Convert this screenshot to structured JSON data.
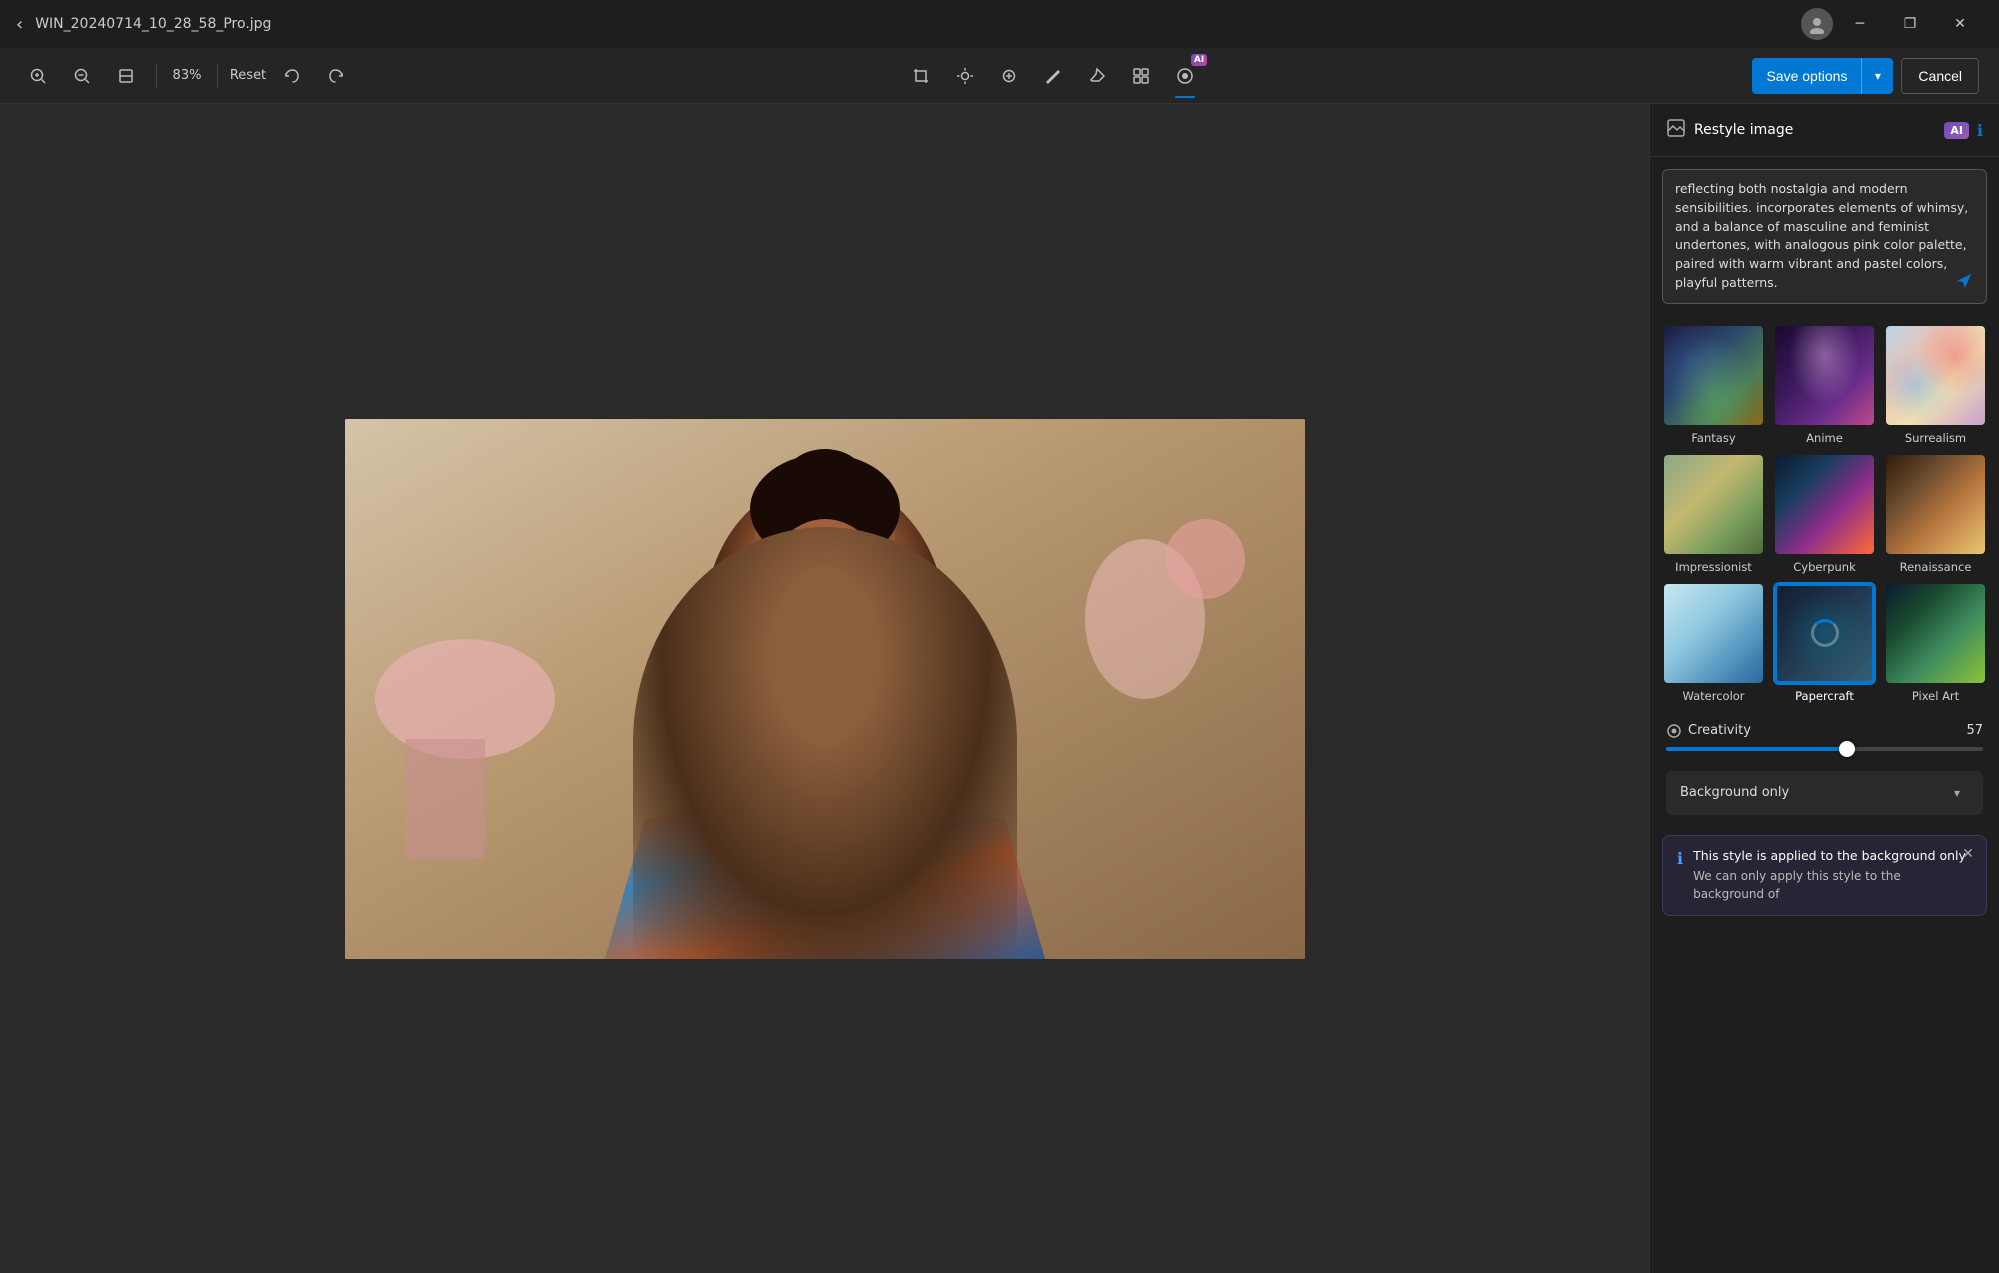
{
  "titlebar": {
    "back_icon": "‹",
    "title": "WIN_20240714_10_28_58_Pro.jpg",
    "avatar_icon": "👤",
    "minimize_icon": "─",
    "restore_icon": "❐",
    "close_icon": "✕"
  },
  "toolbar": {
    "zoom_in_icon": "🔍+",
    "zoom_out_icon": "🔍-",
    "fit_icon": "⊡",
    "zoom_value": "83%",
    "reset_label": "Reset",
    "undo_icon": "↩",
    "redo_icon": "↪",
    "crop_icon": "⤢",
    "brightness_icon": "☀",
    "spot_fix_icon": "⊕",
    "draw_icon": "✏",
    "erase_icon": "◈",
    "filter_icon": "⊞",
    "ai_icon": "AI",
    "save_options_label": "Save options",
    "save_options_arrow": "▾",
    "cancel_label": "Cancel"
  },
  "panel": {
    "header": {
      "icon": "🖼",
      "title": "Restyle image",
      "ai_badge": "AI",
      "info_icon": "ℹ"
    },
    "prompt_text": "reflecting both nostalgia and modern sensibilities. incorporates elements of whimsy, and a balance of masculine and feminist undertones, with analogous pink color palette, paired with warm vibrant and pastel colors, playful patterns.",
    "send_icon": "➤",
    "styles": [
      {
        "id": "fantasy",
        "label": "Fantasy",
        "thumb_class": "thumb-fantasy",
        "selected": false
      },
      {
        "id": "anime",
        "label": "Anime",
        "thumb_class": "thumb-anime",
        "selected": false
      },
      {
        "id": "surrealism",
        "label": "Surrealism",
        "thumb_class": "thumb-surrealism",
        "selected": false
      },
      {
        "id": "impressionist",
        "label": "Impressionist",
        "thumb_class": "thumb-impressionist",
        "selected": false
      },
      {
        "id": "cyberpunk",
        "label": "Cyberpunk",
        "thumb_class": "thumb-cyberpunk",
        "selected": false
      },
      {
        "id": "renaissance",
        "label": "Renaissance",
        "thumb_class": "thumb-renaissance",
        "selected": false
      },
      {
        "id": "watercolor",
        "label": "Watercolor",
        "thumb_class": "thumb-watercolor",
        "selected": false
      },
      {
        "id": "papercraft",
        "label": "Papercraft",
        "thumb_class": "thumb-papercraft",
        "selected": true
      },
      {
        "id": "pixelart",
        "label": "Pixel Art",
        "thumb_class": "thumb-pixelart",
        "selected": false
      }
    ],
    "creativity": {
      "label": "Creativity",
      "icon": "⊙",
      "value": "57",
      "slider_percent": 57
    },
    "background_only": {
      "label": "Background only",
      "chevron": "▾"
    },
    "tooltip": {
      "info_icon": "ℹ",
      "title": "This style is applied to the background only",
      "body": "We can only apply this style to the background of",
      "close_icon": "✕"
    }
  }
}
